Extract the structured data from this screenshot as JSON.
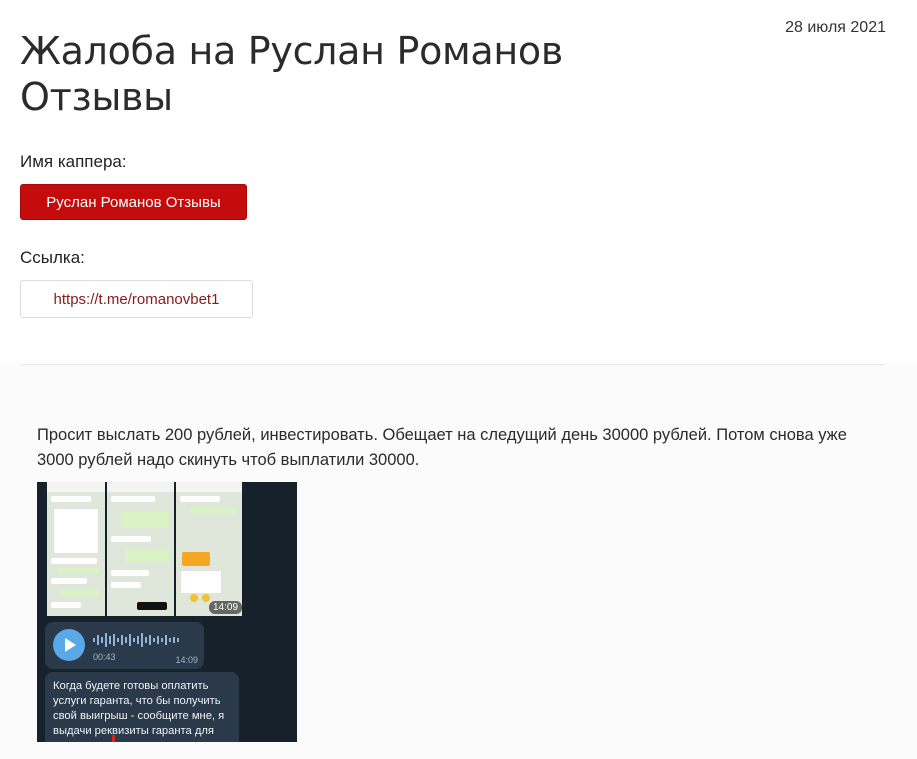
{
  "complaint": {
    "date": "28 июля 2021",
    "title": "Жалоба на Руслан Романов Отзывы",
    "capper_label": "Имя каппера:",
    "capper_name": "Руслан Романов Отзывы",
    "link_label": "Ссылка:",
    "link_url": "https://t.me/romanovbet1",
    "body_text": "Просит выслать 200 рублей, инвестировать. Обещает на следущий день 30000 рублей. Потом снова уже 3000 рублей надо скинуть чтоб выплатили 30000."
  },
  "screenshot": {
    "thumb_time": "14:09",
    "voice_duration": "00:43",
    "voice_time": "14:09",
    "message_text": "Когда будете готовы оплатить услуги гаранта, что бы получить свой выигрыш - сообщите мне, я выдачи реквизиты гаранта для оплаты."
  },
  "colors": {
    "accent": "#c40c0c",
    "link": "#8b1a1a"
  }
}
